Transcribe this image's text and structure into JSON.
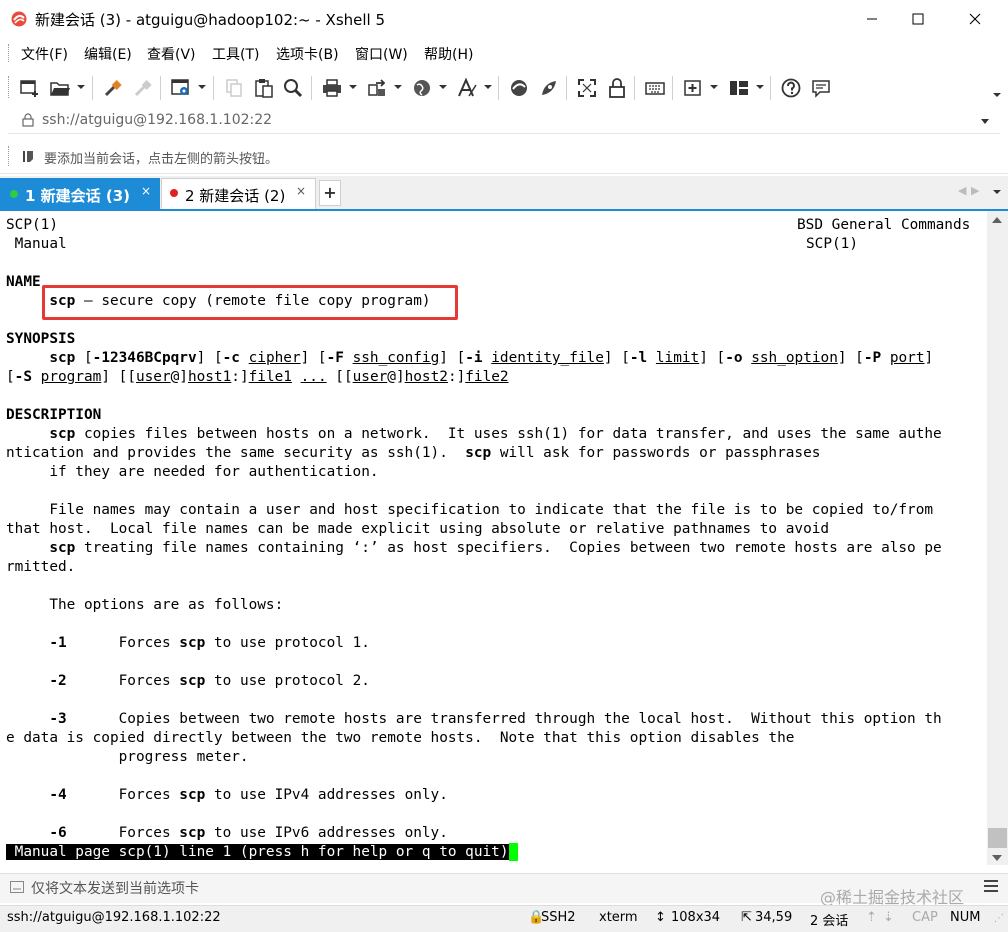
{
  "window": {
    "title": "新建会话 (3) - atguigu@hadoop102:~ - Xshell 5"
  },
  "menu": [
    "文件(F)",
    "编辑(E)",
    "查看(V)",
    "工具(T)",
    "选项卡(B)",
    "窗口(W)",
    "帮助(H)"
  ],
  "toolbar": {
    "icons": [
      "new-session-icon",
      "open-folder-icon",
      "reconnect-icon",
      "disconnect-icon",
      "properties-icon",
      "copy-icon",
      "paste-icon",
      "find-icon",
      "print-icon",
      "transfer-icon",
      "globe-icon",
      "font-icon",
      "xftp-icon",
      "xmanager-icon",
      "fullscreen-icon",
      "lock-icon",
      "keyboard-icon",
      "add-tab-icon",
      "layout-icon",
      "help-icon",
      "chat-icon"
    ]
  },
  "address": {
    "value": "ssh://atguigu@192.168.1.102:22"
  },
  "hint": {
    "text": "要添加当前会话，点击左侧的箭头按钮。"
  },
  "tabs": [
    {
      "label": "1 新建会话 (3)",
      "status": "connected",
      "active": true
    },
    {
      "label": "2 新建会话 (2)",
      "status": "disconnected",
      "active": false
    }
  ],
  "terminal": {
    "header_left": "SCP(1)",
    "header_right": "BSD General Commands",
    "header2_left": " Manual",
    "header2_right": "SCP(1)",
    "name_heading": "NAME",
    "name_cmd": "scp",
    "name_desc": " — secure copy (remote file copy program)",
    "synopsis_heading": "SYNOPSIS",
    "desc_heading": "DESCRIPTION",
    "desc_lines": [
      "copies files between hosts on a network.  It uses ssh(1) for data transfer, and uses the same authe",
      "ntication and provides the same security as ssh(1).  ",
      " will ask for passwords or passphrases",
      "     if they are needed for authentication.",
      "     File names may contain a user and host specification to indicate that the file is to be copied to/from",
      "that host.  Local file names can be made explicit using absolute or relative pathnames to avoid",
      " treating file names containing ‘:’ as host specifiers.  Copies between two remote hosts are also pe",
      "rmitted.",
      "     The options are as follows:"
    ],
    "opt1_flag": "-1",
    "opt1_text": "Forces ",
    "opt1_tail": " to use protocol 1.",
    "opt2_flag": "-2",
    "opt2_text": "Forces ",
    "opt2_tail": " to use protocol 2.",
    "opt3_flag": "-3",
    "opt3_text": "Copies between two remote hosts are transferred through the local host.  Without this option th",
    "opt3_line2": "e data is copied directly between the two remote hosts.  Note that this option disables the",
    "opt3_line3": "progress meter.",
    "opt4_flag": "-4",
    "opt4_text": "Forces ",
    "opt4_tail": " to use IPv4 addresses only.",
    "opt6_flag": "-6",
    "opt6_text": "Forces ",
    "opt6_tail": " to use IPv6 addresses only.",
    "cmd": "scp",
    "status_line": " Manual page scp(1) line 1 (press h for help or q to quit)"
  },
  "compose": {
    "text": "仅将文本发送到当前选项卡",
    "watermark": "@稀土掘金技术社区"
  },
  "statusbar": {
    "connection": "ssh://atguigu@192.168.1.102:22",
    "protocol": "SSH2",
    "terminal_type": "xterm",
    "size": "108x34",
    "cursor_pos": "34,59",
    "sessions": "2 会话",
    "cap": "CAP",
    "num": "NUM"
  },
  "colors": {
    "tab_active": "#1d8bd6",
    "cursor": "#00ff00",
    "highlight": "#e53935"
  }
}
